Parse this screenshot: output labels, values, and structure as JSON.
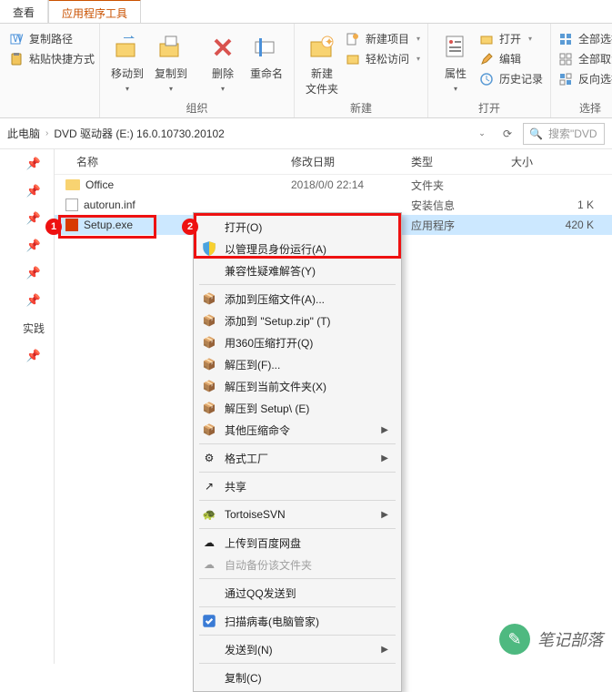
{
  "tabs": {
    "view": "查看",
    "apptools": "应用程序工具"
  },
  "ribbon": {
    "clipboard": {
      "copy_path": "复制路径",
      "paste_shortcut": "粘贴快捷方式"
    },
    "organize": {
      "moveto": "移动到",
      "copyto": "复制到",
      "delete": "删除",
      "rename": "重命名",
      "group": "组织"
    },
    "new": {
      "newfolder": "新建\n文件夹",
      "newitem": "新建项目",
      "easyaccess": "轻松访问",
      "group": "新建"
    },
    "open": {
      "props": "属性",
      "open": "打开",
      "edit": "编辑",
      "history": "历史记录",
      "group": "打开"
    },
    "select": {
      "all": "全部选择",
      "none": "全部取消",
      "invert": "反向选择",
      "group": "选择"
    }
  },
  "breadcrumb": {
    "pc": "此电脑",
    "drive": "DVD 驱动器 (E:) 16.0.10730.20102",
    "search_placeholder": "搜索\"DVD"
  },
  "quick": {
    "label": "实践"
  },
  "columns": {
    "name": "名称",
    "date": "修改日期",
    "type": "类型",
    "size": "大小"
  },
  "files": {
    "office": {
      "name": "Office",
      "date": "2018/0/0 22:14",
      "type": "文件夹",
      "size": ""
    },
    "autorun": {
      "name": "autorun.inf",
      "date": "",
      "type": "安装信息",
      "size": "1 K"
    },
    "setup": {
      "name": "Setup.exe",
      "date": "",
      "type": "应用程序",
      "size": "420 K"
    }
  },
  "menu": {
    "open": "打开(O)",
    "runas_admin": "以管理员身份运行(A)",
    "compat": "兼容性疑难解答(Y)",
    "addarchive": "添加到压缩文件(A)...",
    "addsetupzip": "添加到 \"Setup.zip\" (T)",
    "open360": "用360压缩打开(Q)",
    "extractto": "解压到(F)...",
    "extractcur": "解压到当前文件夹(X)",
    "extractsetup": "解压到 Setup\\ (E)",
    "othercompress": "其他压缩命令",
    "factory": "格式工厂",
    "share": "共享",
    "tortoise": "TortoiseSVN",
    "baidu": "上传到百度网盘",
    "autobackup": "自动备份该文件夹",
    "qq": "通过QQ发送到",
    "scan": "扫描病毒(电脑管家)",
    "sendto": "发送到(N)",
    "copy": "复制(C)"
  },
  "badges": {
    "b1": "1",
    "b2": "2"
  },
  "watermark": {
    "text": "笔记部落"
  }
}
